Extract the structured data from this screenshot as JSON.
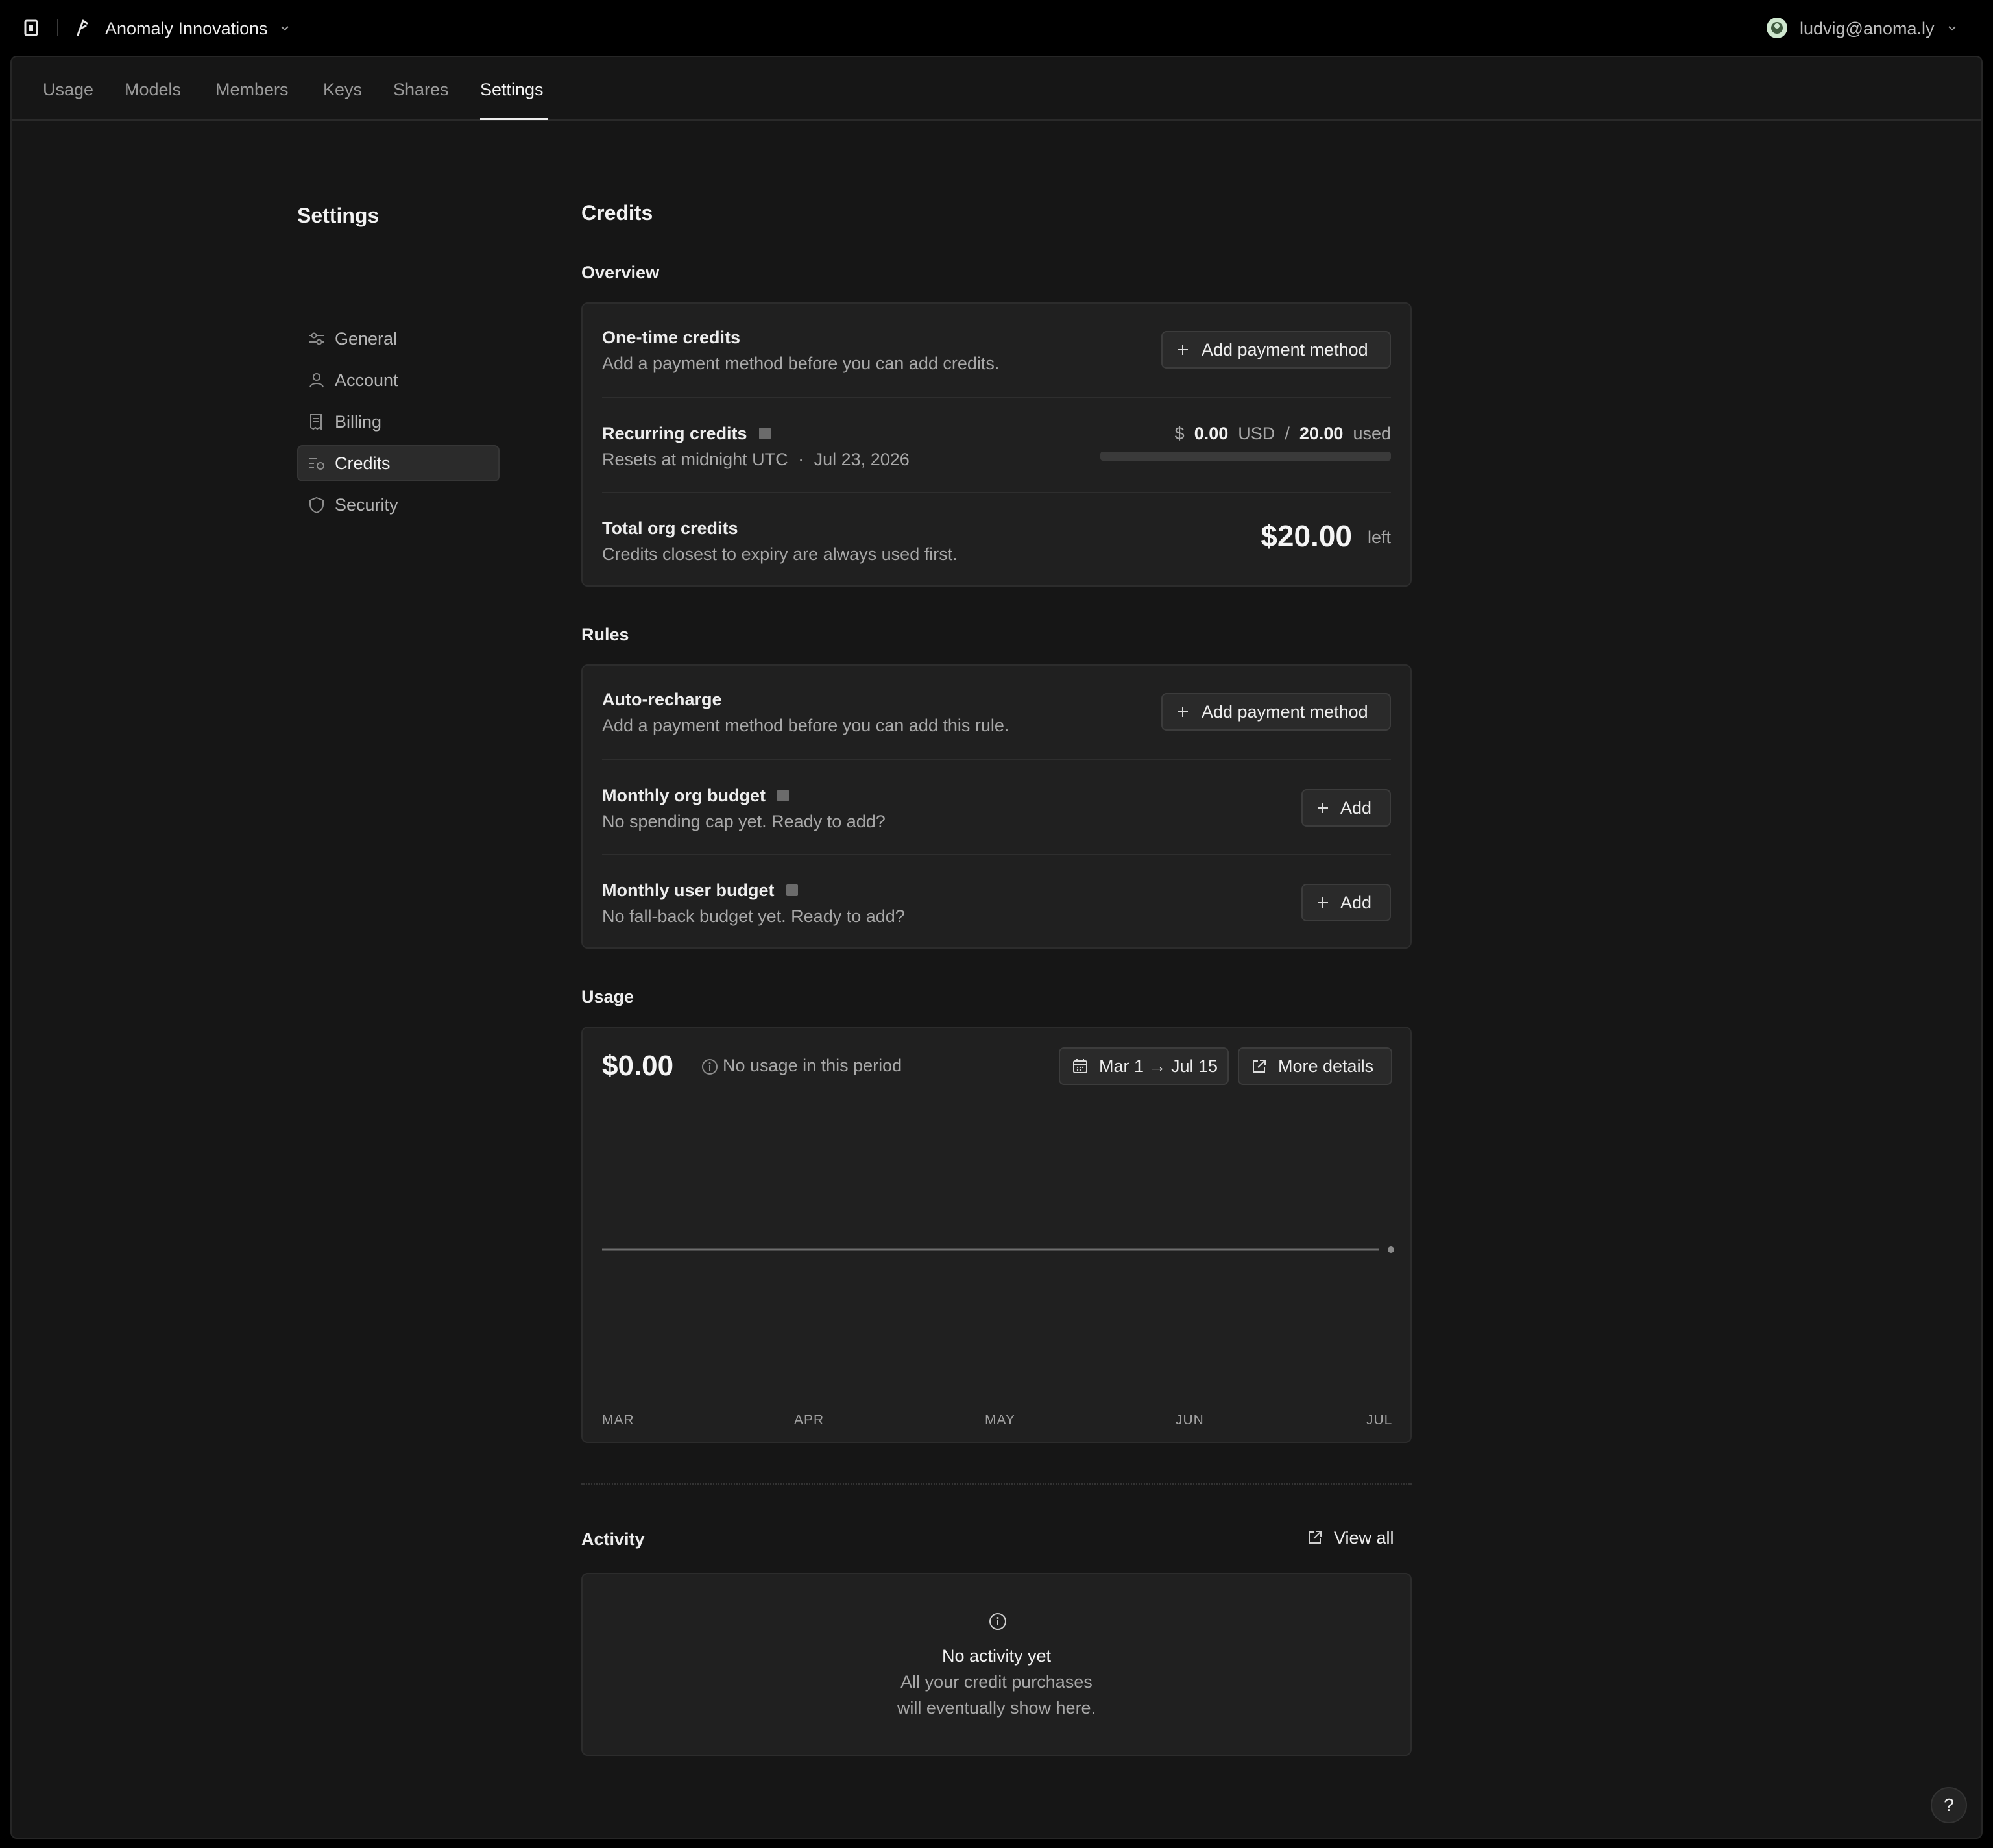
{
  "topbar": {
    "org_name": "Anomaly Innovations",
    "user_email": "ludvig@anoma.ly"
  },
  "tabs": [
    {
      "label": "Usage"
    },
    {
      "label": "Models"
    },
    {
      "label": "Members"
    },
    {
      "label": "Keys"
    },
    {
      "label": "Shares"
    },
    {
      "label": "Settings",
      "active": true
    }
  ],
  "settings_nav": {
    "title": "Settings",
    "items": [
      {
        "label": "General",
        "icon": "sliders-icon"
      },
      {
        "label": "Account",
        "icon": "user-icon"
      },
      {
        "label": "Billing",
        "icon": "receipt-icon"
      },
      {
        "label": "Credits",
        "icon": "credits-icon",
        "active": true
      },
      {
        "label": "Security",
        "icon": "shield-icon"
      }
    ]
  },
  "page_title": "Credits",
  "overview": {
    "heading": "Overview",
    "one_time": {
      "title": "One-time credits",
      "subtitle": "Add a payment method before you can add credits.",
      "button": "Add payment method"
    },
    "recurring": {
      "title": "Recurring credits",
      "subtitle_prefix": "Resets at midnight UTC",
      "subtitle_sep": "·",
      "subtitle_date": "Jul 23, 2026",
      "currency_symbol": "$",
      "used_amount": "0.00",
      "currency": "USD",
      "slash": "/",
      "limit": "20.00",
      "used_label": "used",
      "progress_fraction": 0.0
    },
    "total": {
      "title": "Total org credits",
      "subtitle": "Credits closest to expiry are always used first.",
      "amount": "$20.00",
      "left_label": "left"
    }
  },
  "rules": {
    "heading": "Rules",
    "auto_recharge": {
      "title": "Auto-recharge",
      "subtitle": "Add a payment method before you can add this rule.",
      "button": "Add payment method"
    },
    "monthly_org_budget": {
      "title": "Monthly org budget",
      "subtitle": "No spending cap yet. Ready to add?",
      "button": "Add"
    },
    "monthly_user_budget": {
      "title": "Monthly user budget",
      "subtitle": "No fall-back budget yet. Ready to add?",
      "button": "Add"
    }
  },
  "usage": {
    "heading": "Usage",
    "amount": "$0.00",
    "note": "No usage in this period",
    "date_range_button": "Mar 1 → Jul 15",
    "more_details_button": "More details"
  },
  "chart_data": {
    "type": "line",
    "title": "",
    "xlabel": "",
    "ylabel": "",
    "categories": [
      "MAR",
      "APR",
      "MAY",
      "JUN",
      "JUL"
    ],
    "series": [
      {
        "values": [
          0,
          0,
          0,
          0,
          0
        ]
      }
    ],
    "grid": false,
    "legend": "none"
  },
  "activity": {
    "heading": "Activity",
    "view_all": "View all",
    "empty_title": "No activity yet",
    "empty_line1": "All your credit purchases",
    "empty_line2": "will eventually show here."
  },
  "help_button": "?",
  "colors": {
    "background": "#161616",
    "card": "#202020",
    "text": "#ededed",
    "muted": "#a8a8a8",
    "line": "#6e6e6e"
  }
}
